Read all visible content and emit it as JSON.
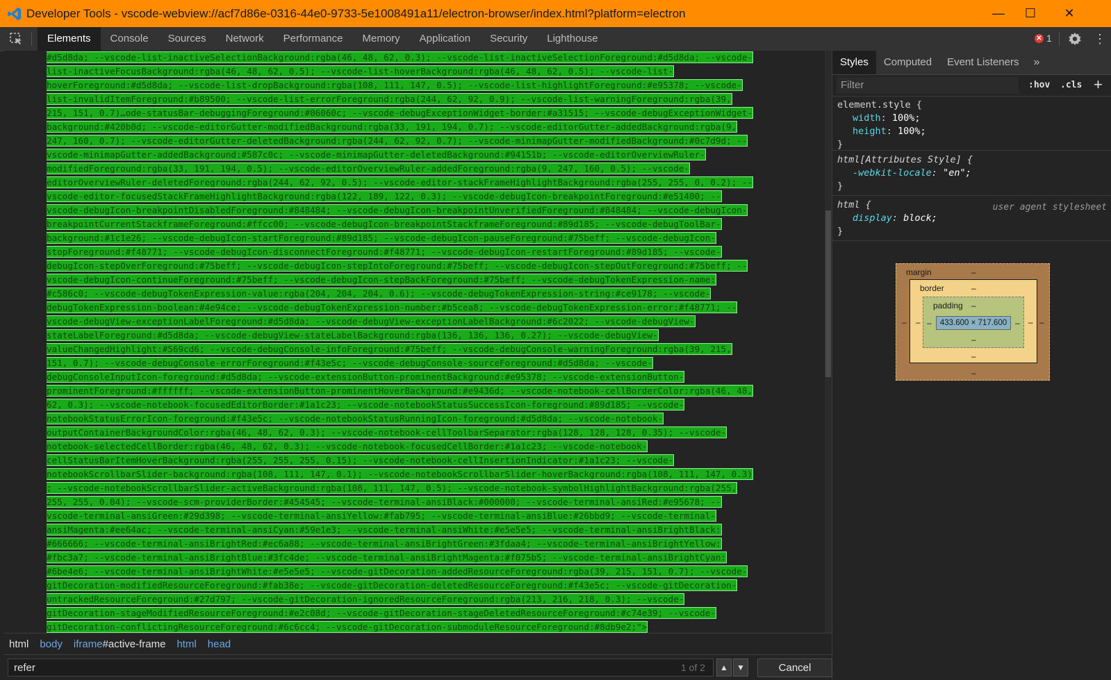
{
  "window": {
    "title": "Developer Tools - vscode-webview://acf7d86e-0316-44e0-9733-5e1008491a11/electron-browser/index.html?platform=electron",
    "minimize_glyph": "—",
    "maximize_glyph": "☐",
    "close_glyph": "✕",
    "accent": "#ff8c00"
  },
  "toolbar": {
    "tabs": [
      "Elements",
      "Console",
      "Sources",
      "Network",
      "Performance",
      "Memory",
      "Application",
      "Security",
      "Lighthouse"
    ],
    "active_tab": "Elements",
    "error_count": "1",
    "error_glyph": "✕",
    "more_glyph": "⋮"
  },
  "elements_panel": {
    "highlight_color": "#1aab1a",
    "code_lines": [
      "#d5d8da; --vscode-list-inactiveSelectionBackground:rgba(46, 48, 62, 0.3); --vscode-list-inactiveSelectionForeground:#d5d8da; --vscode-",
      "list-inactiveFocusBackground:rgba(46, 48, 62, 0.5); --vscode-list-hoverBackground:rgba(46, 48, 62, 0.5); --vscode-list-",
      "hoverForeground:#d5d8da; --vscode-list-dropBackground:rgba(108, 111, 147, 0.5); --vscode-list-highlightForeground:#e95378; --vscode-",
      "list-invalidItemForeground:#b89500; --vscode-list-errorForeground:rgba(244, 62, 92, 0.9); --vscode-list-warningForeground:rgba(39,",
      "215, 151, 0.7)…ode-statusBar-debuggingForeground:#06060c; --vscode-debugExceptionWidget-border:#a31515; --vscode-debugExceptionWidget-",
      "background:#420b0d; --vscode-editorGutter-modifiedBackground:rgba(33, 191, 194, 0.7); --vscode-editorGutter-addedBackground:rgba(9,",
      "247, 160, 0.7); --vscode-editorGutter-deletedBackground:rgba(244, 62, 92, 0.7); --vscode-minimapGutter-modifiedBackground:#0c7d9d; --",
      "vscode-minimapGutter-addedBackground:#587c0c; --vscode-minimapGutter-deletedBackground:#94151b; --vscode-editorOverviewRuler-",
      "modifiedForeground:rgba(33, 191, 194, 0.5); --vscode-editorOverviewRuler-addedForeground:rgba(9, 247, 160, 0.5); --vscode-",
      "editorOverviewRuler-deletedForeground:rgba(244, 62, 92, 0.5); --vscode-editor-stackFrameHighlightBackground:rgba(255, 255, 0, 0.2); --",
      "vscode-editor-focusedStackFrameHighlightBackground:rgba(122, 189, 122, 0.3); --vscode-debugIcon-breakpointForeground:#e51400; --",
      "vscode-debugIcon-breakpointDisabledForeground:#848484; --vscode-debugIcon-breakpointUnverifiedForeground:#848484; --vscode-debugIcon-",
      "breakpointCurrentStackframeForeground:#ffcc00; --vscode-debugIcon-breakpointStackframeForeground:#89d185; --vscode-debugToolBar-",
      "background:#1c1e26; --vscode-debugIcon-startForeground:#89d185; --vscode-debugIcon-pauseForeground:#75beff; --vscode-debugIcon-",
      "stopForeground:#f48771; --vscode-debugIcon-disconnectForeground:#f48771; --vscode-debugIcon-restartForeground:#89d185; --vscode-",
      "debugIcon-stepOverForeground:#75beff; --vscode-debugIcon-stepIntoForeground:#75beff; --vscode-debugIcon-stepOutForeground:#75beff; --",
      "vscode-debugIcon-continueForeground:#75beff; --vscode-debugIcon-stepBackForeground:#75beff; --vscode-debugTokenExpression-name:",
      "#c586c0; --vscode-debugTokenExpression-value:rgba(204, 204, 204, 0.6); --vscode-debugTokenExpression-string:#ce9178; --vscode-",
      "debugTokenExpression-boolean:#4e94ce; --vscode-debugTokenExpression-number:#b5cea8; --vscode-debugTokenExpression-error:#f48771; --",
      "vscode-debugView-exceptionLabelForeground:#d5d8da; --vscode-debugView-exceptionLabelBackground:#6c2022; --vscode-debugView-",
      "stateLabelForeground:#d5d8da; --vscode-debugView-stateLabelBackground:rgba(136, 136, 136, 0.27); --vscode-debugView-",
      "valueChangedHighlight:#569cd6; --vscode-debugConsole-infoForeground:#75beff; --vscode-debugConsole-warningForeground:rgba(39, 215,",
      "151, 0.7); --vscode-debugConsole-errorForeground:#f43e5c; --vscode-debugConsole-sourceForeground:#d5d8da; --vscode-",
      "debugConsoleInputIcon-foreground:#d5d8da; --vscode-extensionButton-prominentBackground:#e95378; --vscode-extensionButton-",
      "prominentForeground:#ffffff; --vscode-extensionButton-prominentHoverBackground:#e9436d; --vscode-notebook-cellBorderColor:rgba(46, 48,",
      "62, 0.3); --vscode-notebook-focusedEditorBorder:#1a1c23; --vscode-notebookStatusSuccessIcon-foreground:#89d185; --vscode-",
      "notebookStatusErrorIcon-foreground:#f43e5c; --vscode-notebookStatusRunningIcon-foreground:#d5d8da; --vscode-notebook-",
      "outputContainerBackgroundColor:rgba(46, 48, 62, 0.3); --vscode-notebook-cellToolbarSeparator:rgba(128, 128, 128, 0.35); --vscode-",
      "notebook-selectedCellBorder:rgba(46, 48, 62, 0.3); --vscode-notebook-focusedCellBorder:#1a1c23; --vscode-notebook-",
      "cellStatusBarItemHoverBackground:rgba(255, 255, 255, 0.15); --vscode-notebook-cellInsertionIndicator:#1a1c23; --vscode-",
      "notebookScrollbarSlider-background:rgba(108, 111, 147, 0.1); --vscode-notebookScrollbarSlider-hoverBackground:rgba(108, 111, 147, 0.3)",
      "; --vscode-notebookScrollbarSlider-activeBackground:rgba(108, 111, 147, 0.5); --vscode-notebook-symbolHighlightBackground:rgba(255,",
      "255, 255, 0.04); --vscode-scm-providerBorder:#454545; --vscode-terminal-ansiBlack:#000000; --vscode-terminal-ansiRed:#e95678; --",
      "vscode-terminal-ansiGreen:#29d398; --vscode-terminal-ansiYellow:#fab795; --vscode-terminal-ansiBlue:#26bbd9; --vscode-terminal-",
      "ansiMagenta:#ee64ac; --vscode-terminal-ansiCyan:#59e1e3; --vscode-terminal-ansiWhite:#e5e5e5; --vscode-terminal-ansiBrightBlack:",
      "#666666; --vscode-terminal-ansiBrightRed:#ec6a88; --vscode-terminal-ansiBrightGreen:#3fdaa4; --vscode-terminal-ansiBrightYellow:",
      "#fbc3a7; --vscode-terminal-ansiBrightBlue:#3fc4de; --vscode-terminal-ansiBrightMagenta:#f075b5; --vscode-terminal-ansiBrightCyan:",
      "#6be4e6; --vscode-terminal-ansiBrightWhite:#e5e5e5; --vscode-gitDecoration-addedResourceForeground:rgba(39, 215, 151, 0.7); --vscode-",
      "gitDecoration-modifiedResourceForeground:#fab38e; --vscode-gitDecoration-deletedResourceForeground:#f43e5c; --vscode-gitDecoration-",
      "untrackedResourceForeground:#27d797; --vscode-gitDecoration-ignoredResourceForeground:rgba(213, 216, 218, 0.3); --vscode-",
      "gitDecoration-stageModifiedResourceForeground:#e2c08d; --vscode-gitDecoration-stageDeletedResourceForeground:#c74e39; --vscode-",
      "gitDecoration-conflictingResourceForeground:#6c6cc4; --vscode-gitDecoration-submoduleResourceForeground:#8db9e2;\">"
    ]
  },
  "breadcrumbs": {
    "items": [
      {
        "tag": "html",
        "suffix": ""
      },
      {
        "tag": "body",
        "suffix": ""
      },
      {
        "tag": "iframe",
        "suffix": "#active-frame"
      },
      {
        "tag": "html",
        "suffix": ""
      },
      {
        "tag": "head",
        "suffix": ""
      }
    ]
  },
  "search": {
    "value": "refer",
    "count": "1 of 2",
    "up_glyph": "▲",
    "down_glyph": "▼",
    "cancel_label": "Cancel"
  },
  "styles_pane": {
    "tabs": [
      "Styles",
      "Computed",
      "Event Listeners"
    ],
    "active_tab": "Styles",
    "more_glyph": "»",
    "filter_placeholder": "Filter",
    "hov_label": ":hov",
    "cls_label": ".cls",
    "add_glyph": "+",
    "rules": [
      {
        "selector": "element.style {",
        "props": [
          {
            "name": "width",
            "value": "100%;"
          },
          {
            "name": "height",
            "value": "100%;"
          }
        ],
        "close": "}"
      },
      {
        "selector": "html[Attributes Style] {",
        "props": [
          {
            "name": "-webkit-locale",
            "value": "\"en\";"
          }
        ],
        "close": "}"
      },
      {
        "selector": "html {",
        "source": "user agent stylesheet",
        "props": [
          {
            "name": "display",
            "value": "block;"
          }
        ],
        "close": "}"
      }
    ]
  },
  "box_model": {
    "margin_label": "margin",
    "border_label": "border",
    "padding_label": "padding",
    "content": "433.600 × 717.600",
    "dash": "–",
    "colors": {
      "margin": "#a87a4b",
      "border": "#f3d38a",
      "padding": "#b6c47d",
      "content": "#88b1c4"
    }
  }
}
